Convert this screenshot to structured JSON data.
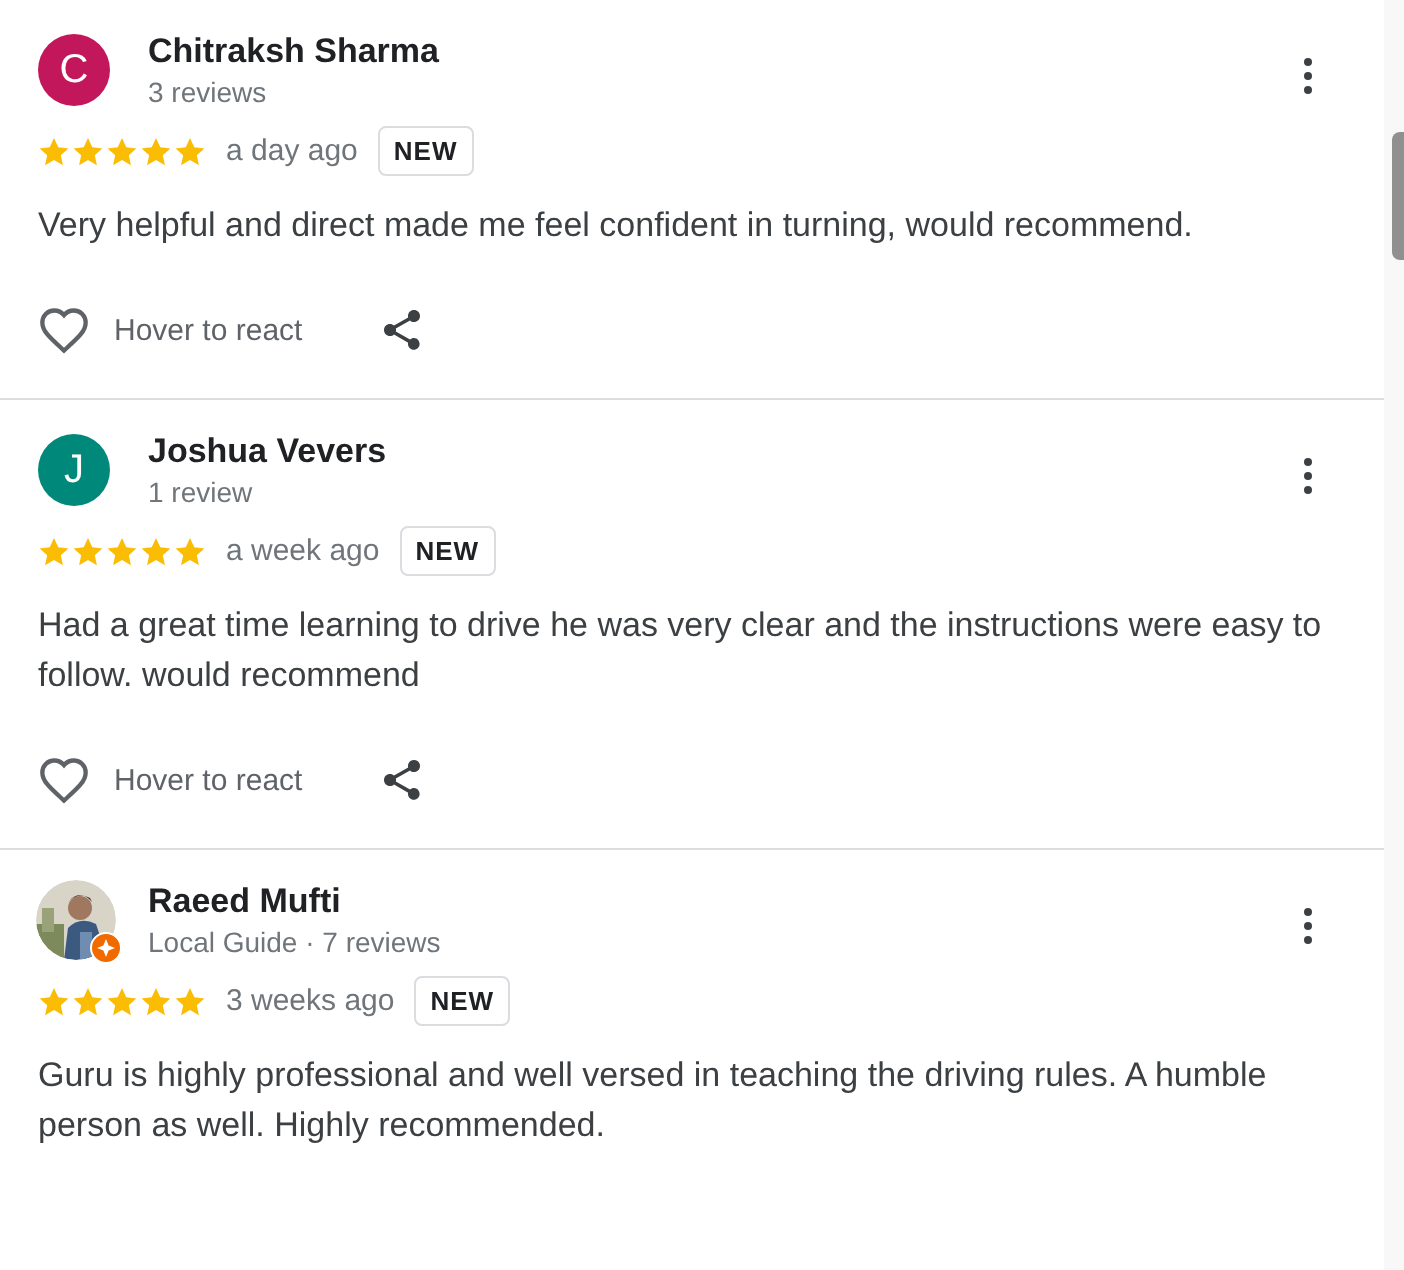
{
  "reviews": [
    {
      "avatar": {
        "kind": "letter",
        "letter": "C",
        "color": "#c2185b"
      },
      "name": "Chitraksh Sharma",
      "subtitle": "3 reviews",
      "local_guide": false,
      "stars": 5,
      "time": "a day ago",
      "badge": "NEW",
      "text": "Very helpful and direct made me feel confident in turning, would recommend.",
      "react_label": "Hover to react"
    },
    {
      "avatar": {
        "kind": "letter",
        "letter": "J",
        "color": "#00897b"
      },
      "name": "Joshua Vevers",
      "subtitle": "1 review",
      "local_guide": false,
      "stars": 5,
      "time": "a week ago",
      "badge": "NEW",
      "text": "Had a great time learning to drive he was very clear and the instructions were easy to follow. would recommend",
      "react_label": "Hover to react"
    },
    {
      "name": "Raeed Mufti",
      "subtitle": "Local Guide · 7 reviews",
      "local_guide": true,
      "stars": 5,
      "time": "3 weeks ago",
      "badge": "NEW",
      "text": "Guru is highly professional and well versed in teaching the driving rules. A humble person as well. Highly recommended."
    }
  ]
}
